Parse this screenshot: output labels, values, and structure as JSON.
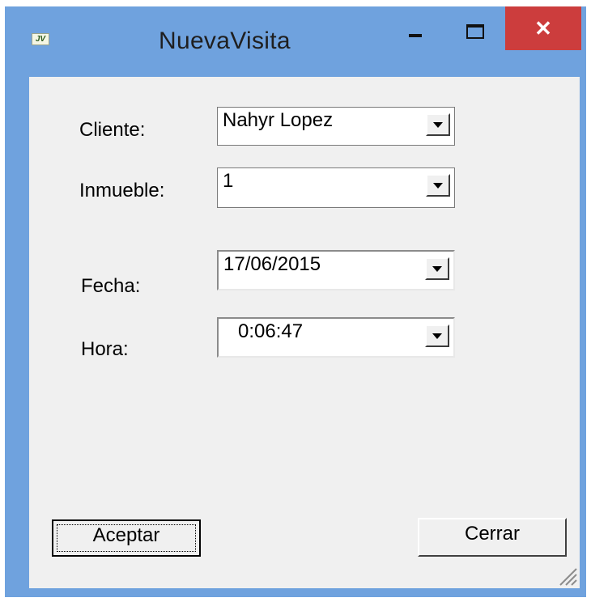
{
  "window": {
    "title": "NuevaVisita",
    "icon": "app-icon",
    "close_glyph": "✕"
  },
  "form": {
    "cliente": {
      "label": "Cliente:",
      "value": "Nahyr Lopez"
    },
    "inmueble": {
      "label": "Inmueble:",
      "value": "1"
    },
    "fecha": {
      "label": "Fecha:",
      "value": "17/06/2015"
    },
    "hora": {
      "label": "Hora:",
      "value": "0:06:47"
    }
  },
  "buttons": {
    "aceptar": "Aceptar",
    "cerrar": "Cerrar"
  },
  "colors": {
    "frame": "#6fa2de",
    "close": "#cc3d3d",
    "client": "#f0f0f0"
  }
}
